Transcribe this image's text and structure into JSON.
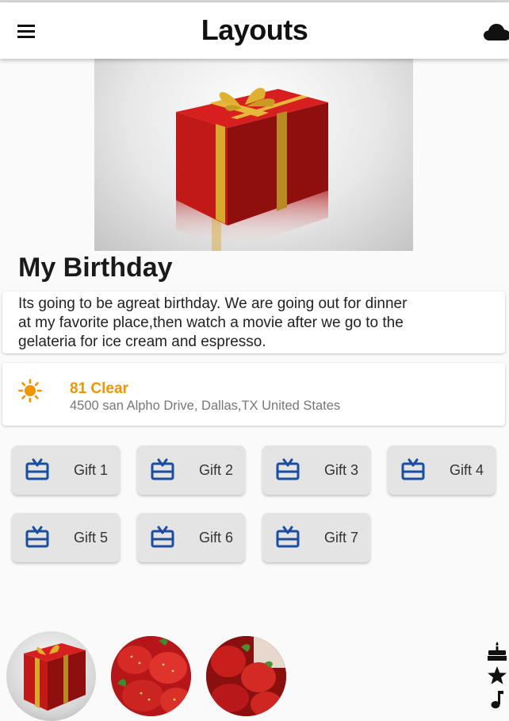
{
  "appbar": {
    "title": "Layouts",
    "menu_icon": "menu-icon",
    "action_icon": "cloud-icon"
  },
  "header_image": "gift-box-photo",
  "birthday": {
    "title": "My Birthday",
    "description": "Its going to be agreat birthday. We are going out for dinner at my favorite place,then watch a movie after we go to the gelateria for ice cream and espresso."
  },
  "weather": {
    "icon": "sunny-icon",
    "summary": "81 Clear",
    "address": "4500 san Alpho Drive, Dallas,TX United States",
    "accent_color": "#f29400"
  },
  "gifts": [
    {
      "label": "Gift 1",
      "icon": "card-giftcard-icon"
    },
    {
      "label": "Gift 2",
      "icon": "card-giftcard-icon"
    },
    {
      "label": "Gift 3",
      "icon": "card-giftcard-icon"
    },
    {
      "label": "Gift 4",
      "icon": "card-giftcard-icon"
    },
    {
      "label": "Gift 5",
      "icon": "card-giftcard-icon"
    },
    {
      "label": "Gift 6",
      "icon": "card-giftcard-icon"
    },
    {
      "label": "Gift 7",
      "icon": "card-giftcard-icon"
    }
  ],
  "gift_icon_color": "#1a4ea1",
  "avatars": [
    "gift-box-photo",
    "strawberries-photo",
    "strawberries-basket-photo"
  ],
  "side_icons": [
    "cake-icon",
    "star-icon",
    "music-note-icon"
  ]
}
